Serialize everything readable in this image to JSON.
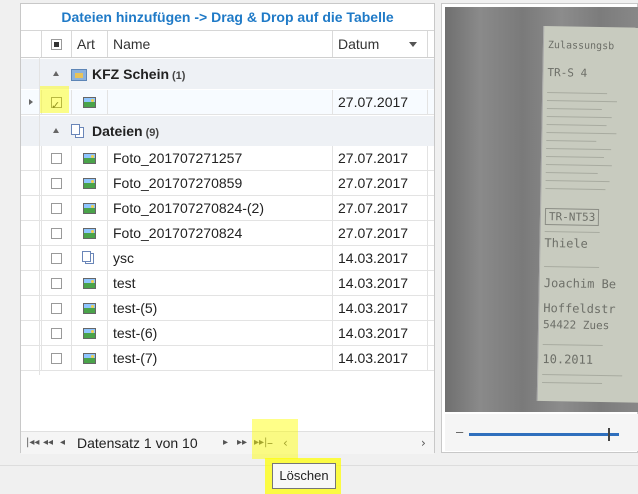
{
  "title": "Dateien hinzufügen -> Drag & Drop auf die Tabelle",
  "columns": {
    "art": "Art",
    "name": "Name",
    "date": "Datum"
  },
  "groups": [
    {
      "label": "KFZ Schein",
      "count": "(1)",
      "rows": [
        {
          "name": "",
          "date": "27.07.2017",
          "icon": "image-icon",
          "checked": true
        }
      ]
    },
    {
      "label": "Dateien",
      "count": "(9)",
      "rows": [
        {
          "name": "Foto_201707271257",
          "date": "27.07.2017",
          "icon": "image-icon",
          "checked": false
        },
        {
          "name": "Foto_201707270859",
          "date": "27.07.2017",
          "icon": "image-icon",
          "checked": false
        },
        {
          "name": "Foto_201707270824-(2)",
          "date": "27.07.2017",
          "icon": "image-icon",
          "checked": false
        },
        {
          "name": "Foto_201707270824",
          "date": "27.07.2017",
          "icon": "image-icon",
          "checked": false
        },
        {
          "name": "ysc",
          "date": "14.03.2017",
          "icon": "document-icon",
          "checked": false
        },
        {
          "name": "test",
          "date": "14.03.2017",
          "icon": "image-icon",
          "checked": false
        },
        {
          "name": "test-(5)",
          "date": "14.03.2017",
          "icon": "image-icon",
          "checked": false
        },
        {
          "name": "test-(6)",
          "date": "14.03.2017",
          "icon": "image-icon",
          "checked": false
        },
        {
          "name": "test-(7)",
          "date": "14.03.2017",
          "icon": "image-icon",
          "checked": false
        }
      ]
    }
  ],
  "navigator": {
    "record_text": "Datensatz 1 von 10",
    "first": "|◂◂",
    "prev_page": "◂◂",
    "prev": "◂",
    "next": "▸",
    "next_page": "▸▸",
    "last": "▸▸|",
    "delete": "–",
    "cancel": "‹",
    "scroll_right": "›"
  },
  "tooltip": "Löschen",
  "preview": {
    "lines": [
      "Zulassungsb",
      "TR-S 4",
      "TR-NT53",
      "Thiele",
      "Joachim Be",
      "Hoffeldstr",
      "54422 Zues",
      "10.2011"
    ]
  },
  "slider": {
    "minus": "–"
  },
  "colors": {
    "title": "#1f7ac7",
    "highlight": "#ffff00",
    "selection": "#e9f2fb",
    "slider": "#2f6fbd"
  }
}
